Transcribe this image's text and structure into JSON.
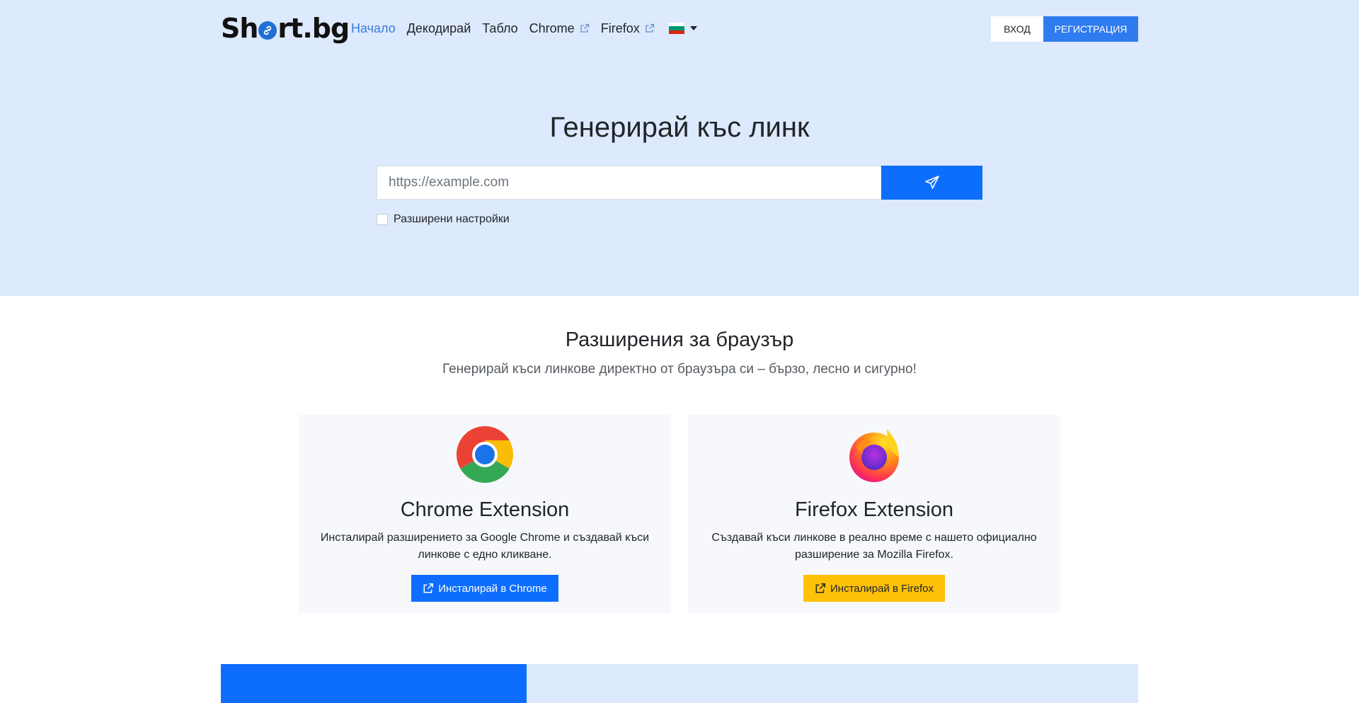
{
  "brand": {
    "name_prefix": "Sh",
    "name_suffix": "rt.bg"
  },
  "nav": {
    "items": [
      {
        "label": "Начало",
        "active": true
      },
      {
        "label": "Декодирай"
      },
      {
        "label": "Табло"
      },
      {
        "label": "Chrome",
        "external": true
      },
      {
        "label": "Firefox",
        "external": true
      }
    ],
    "language_flag": "bulgarian-flag"
  },
  "auth": {
    "login_label": "ВХОД",
    "register_label": "РЕГИСТРАЦИЯ"
  },
  "hero": {
    "title": "Генерирай къс линк",
    "url_placeholder": "https://example.com",
    "submit_icon": "send-icon",
    "advanced_label": "Разширени настройки"
  },
  "extensions": {
    "title": "Разширения за браузър",
    "subtitle": "Генерирай къси линкове директно от браузъра си – бързо, лесно и сигурно!",
    "cards": [
      {
        "icon": "chrome-logo-icon",
        "title": "Chrome Extension",
        "description": "Инсталирай разширението за Google Chrome и създавай къси линкове с едно кликване.",
        "button_label": "Инсталирай в Chrome"
      },
      {
        "icon": "firefox-logo-icon",
        "title": "Firefox Extension",
        "description": "Създавай къси линкове в реално време с нашето официално разширение за Mozilla Firefox.",
        "button_label": "Инсталирай в Firefox"
      }
    ]
  },
  "colors": {
    "hero_bg": "#dde9fc",
    "primary": "#0d6efd",
    "warning": "#ffc107",
    "active_link": "#3b7bd8"
  }
}
